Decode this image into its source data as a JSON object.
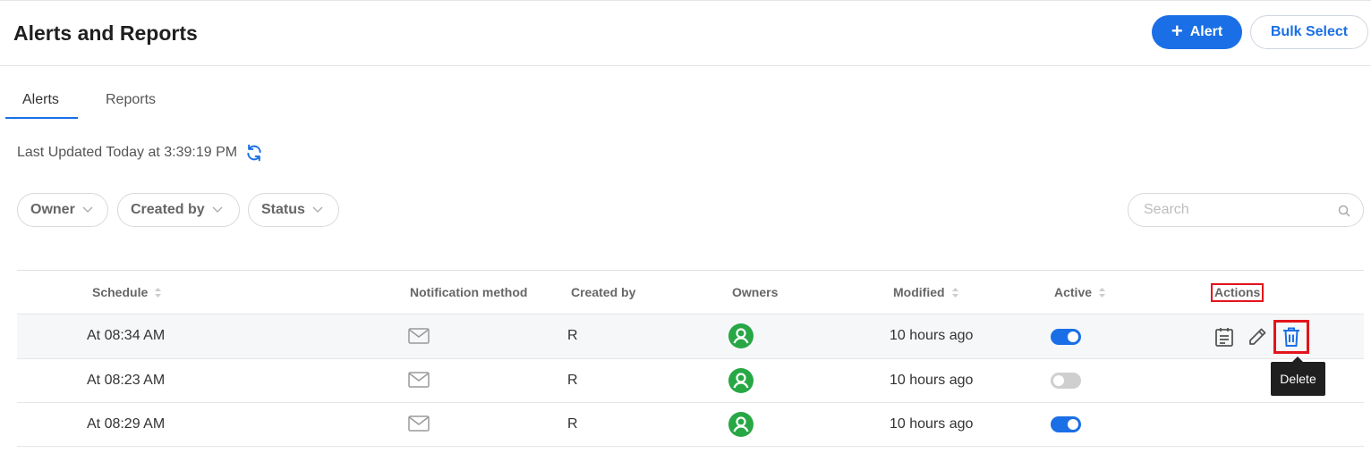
{
  "header": {
    "title": "Alerts and Reports",
    "alert_button": "Alert",
    "bulk_select_button": "Bulk Select"
  },
  "tabs": [
    {
      "label": "Alerts",
      "active": true
    },
    {
      "label": "Reports",
      "active": false
    }
  ],
  "last_updated": "Last Updated Today at 3:39:19 PM",
  "filters": [
    {
      "label": "Owner"
    },
    {
      "label": "Created by"
    },
    {
      "label": "Status"
    }
  ],
  "search": {
    "placeholder": "Search",
    "value": ""
  },
  "table": {
    "columns": [
      "Schedule",
      "Notification method",
      "Created by",
      "Owners",
      "Modified",
      "Active",
      "Actions"
    ],
    "rows": [
      {
        "schedule": "At 08:34 AM",
        "notification": "email",
        "created_by": "R",
        "owner_icon": "user-icon",
        "modified": "10 hours ago",
        "active": true
      },
      {
        "schedule": "At 08:23 AM",
        "notification": "email",
        "created_by": "R",
        "owner_icon": "user-icon",
        "modified": "10 hours ago",
        "active": false
      },
      {
        "schedule": "At 08:29 AM",
        "notification": "email",
        "created_by": "R",
        "owner_icon": "user-icon",
        "modified": "10 hours ago",
        "active": true
      }
    ]
  },
  "tooltip": {
    "text": "Delete"
  },
  "colors": {
    "primary": "#1a6fe6",
    "owner_avatar": "#28a745",
    "highlight": "#e3141b"
  }
}
